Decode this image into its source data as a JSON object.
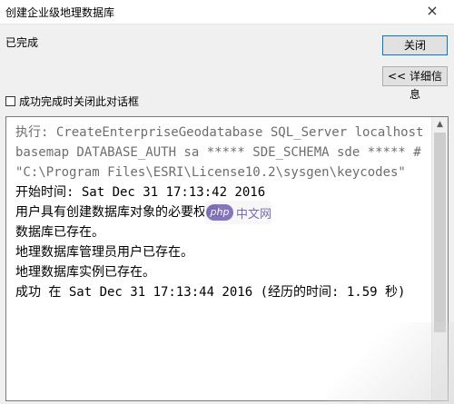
{
  "window": {
    "title": "创建企业级地理数据库",
    "close_glyph": "×"
  },
  "status": {
    "text": "已完成"
  },
  "buttons": {
    "close_label": "关闭",
    "details_label": "<< 详细信息"
  },
  "option": {
    "close_on_success_label": "成功完成时关闭此对话框",
    "checked": false
  },
  "log": {
    "lines": [
      {
        "text": "执行: CreateEnterpriseGeodatabase SQL_Server localhost basemap DATABASE_AUTH sa ***** SDE_SCHEMA sde ***** # \"C:\\Program Files\\ESRI\\License10.2\\sysgen\\keycodes\"",
        "style": "gray"
      },
      {
        "text": "开始时间: Sat Dec 31 17:13:42 2016",
        "style": "normal"
      },
      {
        "text": "用户具有创建数据库对象的必要权限。",
        "style": "normal"
      },
      {
        "text": "数据库已存在。",
        "style": "normal"
      },
      {
        "text": "地理数据库管理员用户已存在。",
        "style": "normal"
      },
      {
        "text": "地理数据库实例已存在。",
        "style": "normal"
      },
      {
        "text": "成功 在 Sat Dec 31 17:13:44 2016 (经历的时间: 1.59 秒)",
        "style": "normal"
      }
    ]
  },
  "watermark": {
    "badge": "php",
    "site": "中文网"
  },
  "icons": {
    "scroll_up": "▲"
  }
}
